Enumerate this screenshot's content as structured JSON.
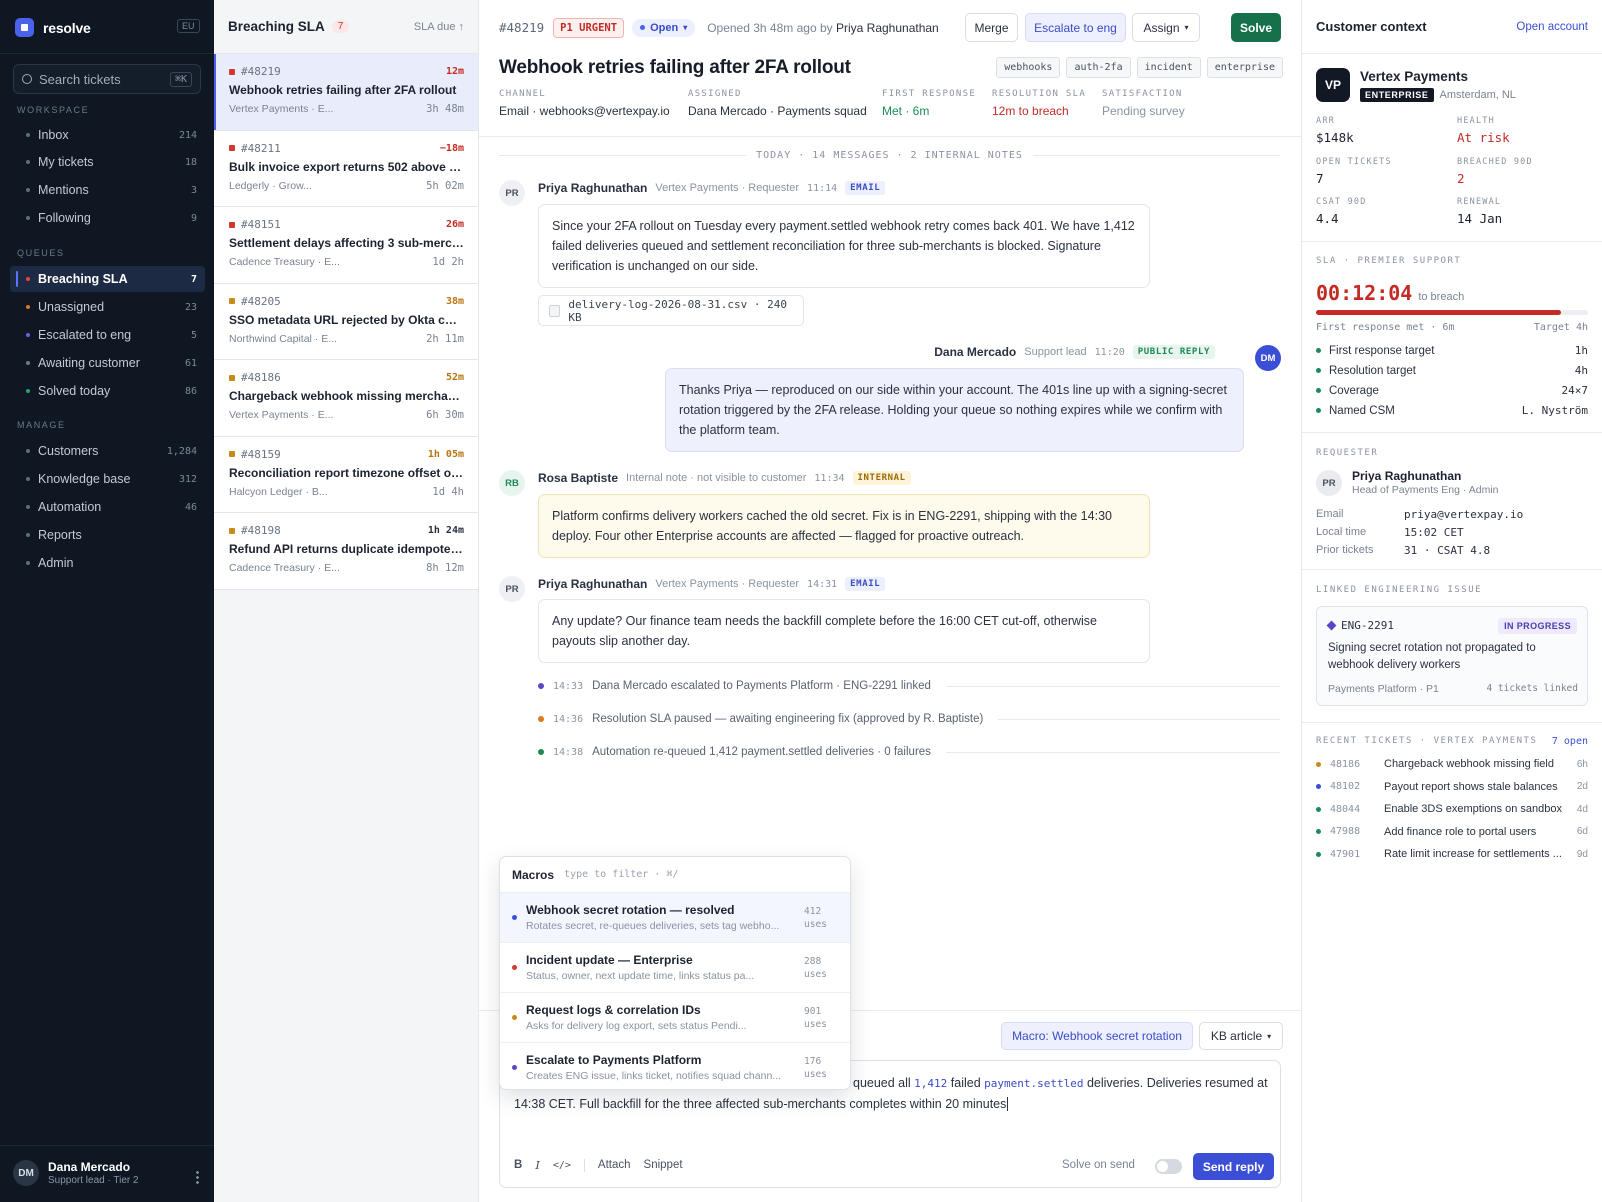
{
  "app": {
    "name": "resolve",
    "region": "EU"
  },
  "search": {
    "placeholder": "Search tickets",
    "shortcut": "⌘K"
  },
  "sidebar": {
    "workspace_label": "WORKSPACE",
    "workspace": [
      {
        "label": "Inbox",
        "count": "214"
      },
      {
        "label": "My tickets",
        "count": "18"
      },
      {
        "label": "Mentions",
        "count": "3"
      },
      {
        "label": "Following",
        "count": "9"
      }
    ],
    "queues_label": "QUEUES",
    "queues": [
      {
        "label": "Breaching SLA",
        "count": "7",
        "color": "#e2473f"
      },
      {
        "label": "Unassigned",
        "count": "23",
        "color": "#d97a1c"
      },
      {
        "label": "Escalated to eng",
        "count": "5",
        "color": "#7a5ae0"
      },
      {
        "label": "Awaiting customer",
        "count": "61",
        "color": "#6d7888"
      },
      {
        "label": "Solved today",
        "count": "86",
        "color": "#2aa070"
      }
    ],
    "manage_label": "MANAGE",
    "manage": [
      {
        "label": "Customers",
        "count": "1,284"
      },
      {
        "label": "Knowledge base",
        "count": "312"
      },
      {
        "label": "Automation",
        "count": "46"
      },
      {
        "label": "Reports",
        "count": ""
      },
      {
        "label": "Admin",
        "count": ""
      }
    ],
    "user": {
      "initials": "DM",
      "name": "Dana Mercado",
      "role": "Support lead · Tier 2"
    }
  },
  "list": {
    "title": "Breaching SLA",
    "count": "7",
    "sort": "SLA due ↑",
    "tickets": [
      {
        "id": "#48219",
        "sla": "12m",
        "title": "Webhook retries failing after 2FA rollout",
        "org": "Vertex Payments · E...",
        "age": "3h 48m",
        "color": "#d2392f",
        "sla_color": "#c42b24"
      },
      {
        "id": "#48211",
        "sla": "−18m",
        "title": "Bulk invoice export returns 502 above 5k...",
        "org": "Ledgerly · Grow...",
        "age": "5h 02m",
        "color": "#d2392f",
        "sla_color": "#c42b24"
      },
      {
        "id": "#48151",
        "sla": "26m",
        "title": "Settlement delays affecting 3 sub-merch...",
        "org": "Cadence Treasury · E...",
        "age": "1d 2h",
        "color": "#d2392f",
        "sla_color": "#c42b24"
      },
      {
        "id": "#48205",
        "sla": "38m",
        "title": "SSO metadata URL rejected by Okta conn...",
        "org": "Northwind Capital · E...",
        "age": "2h 11m",
        "color": "#c98a1a",
        "sla_color": "#b8750f"
      },
      {
        "id": "#48186",
        "sla": "52m",
        "title": "Chargeback webhook missing merchant_...",
        "org": "Vertex Payments · E...",
        "age": "6h 30m",
        "color": "#c98a1a",
        "sla_color": "#b8750f"
      },
      {
        "id": "#48159",
        "sla": "1h 05m",
        "title": "Reconciliation report timezone offset off ...",
        "org": "Halcyon Ledger · B...",
        "age": "1d 4h",
        "color": "#c98a1a",
        "sla_color": "#b8750f"
      },
      {
        "id": "#48198",
        "sla": "1h 24m",
        "title": "Refund API returns duplicate idempoten...",
        "org": "Cadence Treasury · E...",
        "age": "8h 12m",
        "color": "#c98a1a",
        "sla_color": "#2a3140"
      }
    ]
  },
  "ticket": {
    "id": "#48219",
    "priority": "P1 URGENT",
    "status": "Open",
    "opened": "Opened 3h 48m ago by",
    "opened_by": "Priya Raghunathan",
    "actions": {
      "merge": "Merge",
      "escalate": "Escalate to eng",
      "assign": "Assign",
      "solve": "Solve"
    },
    "title": "Webhook retries failing after 2FA rollout",
    "tags": [
      "webhooks",
      "auth-2fa",
      "incident",
      "enterprise"
    ],
    "meta": [
      {
        "key": "CHANNEL",
        "value": "Email · webhooks@vertexpay.io",
        "color": "#2a3140"
      },
      {
        "key": "ASSIGNED",
        "value": "Dana Mercado · Payments squad",
        "color": "#2a3140"
      },
      {
        "key": "FIRST RESPONSE",
        "value": "Met · 6m",
        "color": "#1d8a55"
      },
      {
        "key": "RESOLUTION SLA",
        "value": "12m to breach",
        "color": "#c42b24"
      },
      {
        "key": "SATISFACTION",
        "value": "Pending survey",
        "color": "#8a93a2"
      }
    ],
    "day_separator": "TODAY · 14 MESSAGES · 2 INTERNAL NOTES"
  },
  "messages": [
    {
      "initials": "PR",
      "name": "Priya Raghunathan",
      "sub": "Vertex Payments · Requester",
      "time": "11:14",
      "badge": "EMAIL",
      "text": "Since your 2FA rollout on Tuesday every payment.settled webhook retry comes back 401. We have 1,412 failed deliveries queued and settlement reconciliation for three sub-merchants is blocked. Signature verification is unchanged on our side."
    },
    {
      "initials": "DM",
      "name": "Dana Mercado",
      "sub": "Support lead",
      "time": "11:20",
      "badge": "PUBLIC REPLY",
      "text": "Thanks Priya — reproduced on our side within your account. The 401s line up with a signing-secret rotation triggered by the 2FA release. Holding your queue so nothing expires while we confirm with the platform team."
    },
    {
      "initials": "RB",
      "name": "Rosa Baptiste",
      "sub": "Internal note · not visible to customer",
      "time": "11:34",
      "badge": "INTERNAL",
      "text": "Platform confirms delivery workers cached the old secret. Fix is in ENG-2291, shipping with the 14:30 deploy. Four other Enterprise accounts are affected — flagged for proactive outreach."
    },
    {
      "initials": "PR",
      "name": "Priya Raghunathan",
      "sub": "Vertex Payments · Requester",
      "time": "14:31",
      "badge": "EMAIL",
      "text": "Any update? Our finance team needs the backfill complete before the 16:00 CET cut-off, otherwise payouts slip another day."
    }
  ],
  "attachment": "delivery-log-2026-08-31.csv · 240 KB",
  "events": [
    {
      "time": "14:33",
      "text": "Dana Mercado escalated to Payments Platform · ENG-2291 linked",
      "color": "#5b45c9"
    },
    {
      "time": "14:36",
      "text": "Resolution SLA paused — awaiting engineering fix (approved by R. Baptiste)",
      "color": "#d97a1c"
    },
    {
      "time": "14:38",
      "text": "Automation re-queued 1,412 payment.settled deliveries · 0 failures",
      "color": "#1d8a55"
    }
  ],
  "macros": {
    "title": "Macros",
    "hint": "type to filter · ⌘/",
    "items": [
      {
        "title": "Webhook secret rotation — resolved",
        "desc": "Rotates secret, re-queues deliveries, sets tag webho...",
        "uses": "412",
        "uses_label": "uses",
        "color": "#3b4fd6"
      },
      {
        "title": "Incident update — Enterprise",
        "desc": "Status, owner, next update time, links status pa...",
        "uses": "288",
        "uses_label": "uses",
        "color": "#d2392f"
      },
      {
        "title": "Request logs & correlation IDs",
        "desc": "Asks for delivery log export, sets status Pendi...",
        "uses": "901",
        "uses_label": "uses",
        "color": "#c98a1a"
      },
      {
        "title": "Escalate to Payments Platform",
        "desc": "Creates ENG issue, links ticket, notifies squad chann...",
        "uses": "176",
        "uses_label": "uses",
        "color": "#5b45c9"
      }
    ]
  },
  "composer": {
    "macro_button": "Macro: Webhook secret rotation",
    "kb_button": "KB article",
    "text_pre": "queued all ",
    "text_num": "1,412",
    "text_mid": " failed ",
    "text_code": "payment.settled",
    "text_post": " deliveries. Deliveries resumed at 14:38 CET. Full backfill for the three affected sub-merchants completes within 20 minutes",
    "tools": {
      "bold": "B",
      "italic": "I",
      "code": "</>",
      "attach": "Attach",
      "snippet": "Snippet"
    },
    "solve_on_send": "Solve on send",
    "send": "Send reply"
  },
  "context": {
    "title": "Customer context",
    "open_account": "Open account",
    "customer": {
      "initials": "VP",
      "name": "Vertex Payments",
      "tier": "ENTERPRISE",
      "location": "Amsterdam, NL"
    },
    "stats": [
      {
        "key": "ARR",
        "value": "$148k",
        "color": "#1c2230"
      },
      {
        "key": "HEALTH",
        "value": "At risk",
        "color": "#c42b24"
      },
      {
        "key": "OPEN TICKETS",
        "value": "7",
        "color": "#1c2230"
      },
      {
        "key": "BREACHED 90D",
        "value": "2",
        "color": "#c42b24"
      },
      {
        "key": "CSAT 90D",
        "value": "4.4",
        "color": "#1c2230"
      },
      {
        "key": "RENEWAL",
        "value": "14 Jan",
        "color": "#1c2230"
      }
    ],
    "sla": {
      "label": "SLA · PREMIER SUPPORT",
      "timer": "00:12:04",
      "timer_sub": "to breach",
      "progress": 0.9,
      "left_label": "First response met · 6m",
      "right_label": "Target 4h",
      "rows": [
        {
          "label": "First response target",
          "value": "1h",
          "color": "#1d8a55"
        },
        {
          "label": "Resolution target",
          "value": "4h",
          "color": "#1d8a55"
        },
        {
          "label": "Coverage",
          "value": "24×7",
          "color": "#1d8a55"
        },
        {
          "label": "Named CSM",
          "value": "L. Nyström",
          "color": "#1d8a55"
        }
      ]
    },
    "requester": {
      "label": "REQUESTER",
      "initials": "PR",
      "name": "Priya Raghunathan",
      "title": "Head of Payments Eng · Admin",
      "rows": [
        {
          "key": "Email",
          "value": "priya@vertexpay.io"
        },
        {
          "key": "Local time",
          "value": "15:02 CET"
        },
        {
          "key": "Prior tickets",
          "value": "31 · CSAT 4.8"
        }
      ]
    },
    "eng": {
      "label": "LINKED ENGINEERING ISSUE",
      "id": "ENG-2291",
      "status": "IN PROGRESS",
      "desc": "Signing secret rotation not propagated to webhook delivery workers",
      "team": "Payments Platform · P1",
      "linked": "4 tickets linked"
    },
    "recent": {
      "label": "RECENT TICKETS · VERTEX PAYMENTS",
      "open": "7 open",
      "items": [
        {
          "id": "48186",
          "title": "Chargeback webhook missing field",
          "age": "6h",
          "color": "#c98a1a"
        },
        {
          "id": "48102",
          "title": "Payout report shows stale balances",
          "age": "2d",
          "color": "#3b4fd6"
        },
        {
          "id": "48044",
          "title": "Enable 3DS exemptions on sandbox",
          "age": "4d",
          "color": "#1d8a55"
        },
        {
          "id": "47988",
          "title": "Add finance role to portal users",
          "age": "6d",
          "color": "#1d8a55"
        },
        {
          "id": "47901",
          "title": "Rate limit increase for settlements ...",
          "age": "9d",
          "color": "#1d8a55"
        }
      ]
    }
  }
}
